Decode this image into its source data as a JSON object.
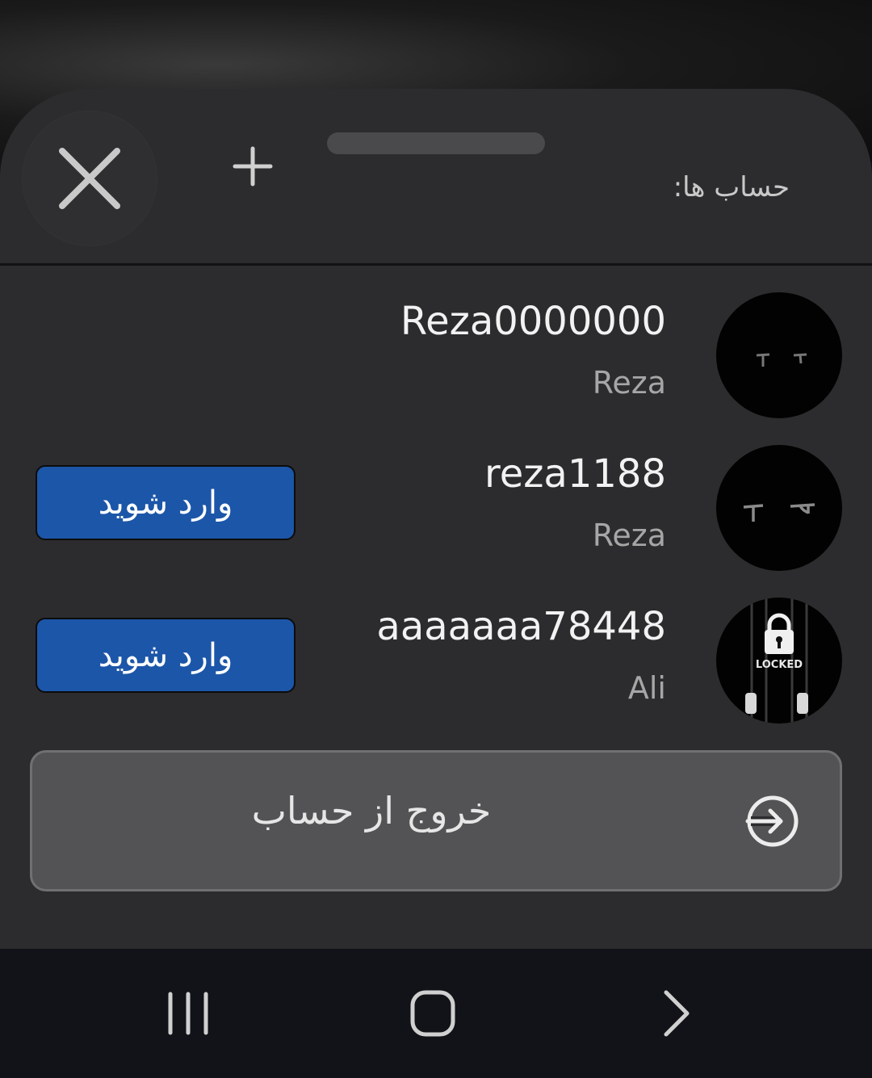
{
  "sheet": {
    "title": "حساب ها:",
    "close_icon": "close-icon",
    "add_icon": "plus-icon"
  },
  "accounts": [
    {
      "username": "Reza0000000",
      "display_name": "Reza",
      "avatar": "dark-face-avatar",
      "login_label": ""
    },
    {
      "username": "reza1188",
      "display_name": "Reza",
      "avatar": "dark-face-avatar",
      "login_label": "وارد شوید"
    },
    {
      "username": "aaaaaaa78448",
      "display_name": "Ali",
      "avatar": "locked-avatar",
      "avatar_text": "LOCKED",
      "login_label": "وارد شوید"
    }
  ],
  "logout": {
    "label": "خروج از حساب",
    "icon": "sign-in-arrow-icon"
  },
  "navbar": {
    "recent_icon": "recent-apps-icon",
    "home_icon": "home-icon",
    "back_icon": "back-chevron-icon"
  },
  "colors": {
    "sheet_bg": "#2c2c2e",
    "login_button": "#1c56a8",
    "logout_button": "#535355",
    "navbar_bg": "#111318"
  }
}
